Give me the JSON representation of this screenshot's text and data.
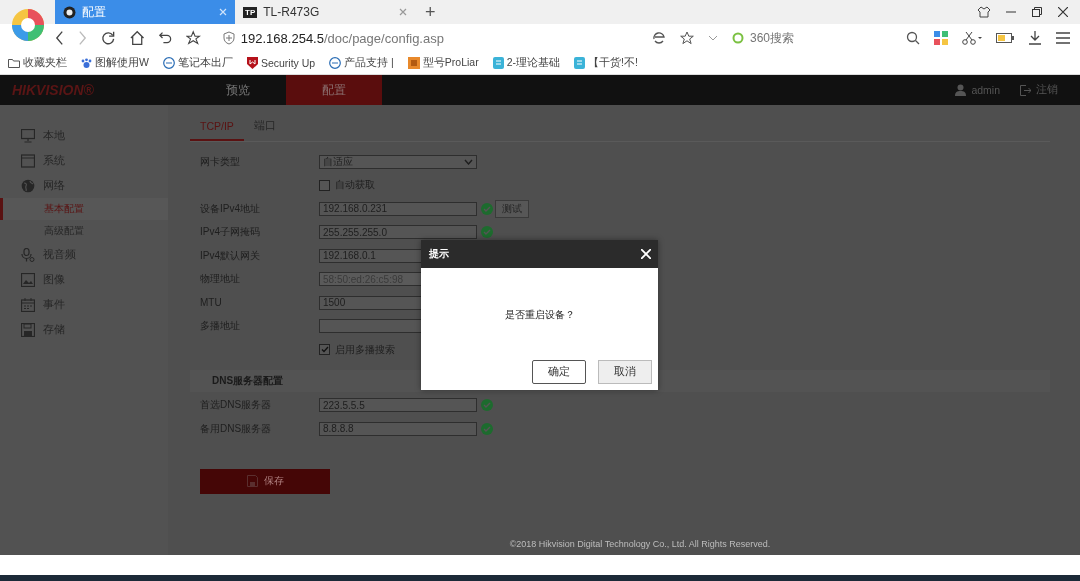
{
  "browser": {
    "tabs": [
      {
        "title": "配置",
        "selected": true
      },
      {
        "title": "TL-R473G",
        "selected": false,
        "badge": "TP"
      }
    ],
    "new_tab": "+",
    "address": {
      "host": "192.168.254.5",
      "path": "/doc/page/config.asp"
    },
    "search": {
      "placeholder": "360搜索"
    },
    "bookmarks": [
      "收藏夹栏",
      "图解使用W",
      "笔记本出厂",
      "Security Up",
      "产品支持 |",
      "型号ProLiar",
      "2-理论基础",
      "【干货!不!"
    ]
  },
  "app": {
    "logo": "HIKVISION®",
    "nav": [
      {
        "label": "预览",
        "selected": false
      },
      {
        "label": "配置",
        "selected": true
      }
    ],
    "user": "admin",
    "logout": "注销",
    "sidebar": [
      {
        "label": "本地",
        "selected": false
      },
      {
        "label": "系统",
        "selected": false
      },
      {
        "label": "网络",
        "selected": false,
        "children": [
          {
            "label": "基本配置",
            "selected": true
          },
          {
            "label": "高级配置",
            "selected": false
          }
        ]
      },
      {
        "label": "视音频",
        "selected": false
      },
      {
        "label": "图像",
        "selected": false
      },
      {
        "label": "事件",
        "selected": false
      },
      {
        "label": "存储",
        "selected": false
      }
    ],
    "tabs": [
      {
        "label": "TCP/IP",
        "selected": true
      },
      {
        "label": "端口",
        "selected": false
      }
    ],
    "form": [
      {
        "kind": "select",
        "label": "网卡类型",
        "value": "自适应"
      },
      {
        "kind": "checkbox",
        "label": "自动获取",
        "checked": false
      },
      {
        "kind": "input",
        "label": "设备IPv4地址",
        "value": "192.168.0.231",
        "valid": true,
        "button": "测试"
      },
      {
        "kind": "input",
        "label": "IPv4子网掩码",
        "value": "255.255.255.0",
        "valid": true
      },
      {
        "kind": "input",
        "label": "IPv4默认网关",
        "value": "192.168.0.1"
      },
      {
        "kind": "input",
        "label": "物理地址",
        "value": "58:50:ed:26:c5:98",
        "disabled": true
      },
      {
        "kind": "input",
        "label": "MTU",
        "value": "1500"
      },
      {
        "kind": "input",
        "label": "多播地址"
      },
      {
        "kind": "checkbox",
        "label": "启用多播搜索",
        "checked": true
      }
    ],
    "dns": {
      "title": "DNS服务器配置",
      "rows": [
        {
          "label": "首选DNS服务器",
          "value": "223.5.5.5",
          "valid": true
        },
        {
          "label": "备用DNS服务器",
          "value": "8.8.8.8",
          "valid": true
        }
      ]
    },
    "save": "保存",
    "footer": "©2018 Hikvision Digital Technology Co., Ltd. All Rights Reserved."
  },
  "dialog": {
    "title": "提示",
    "message": "是否重启设备？",
    "buttons": [
      {
        "label": "确定",
        "focused": true
      },
      {
        "label": "取消",
        "focused": false
      }
    ]
  }
}
